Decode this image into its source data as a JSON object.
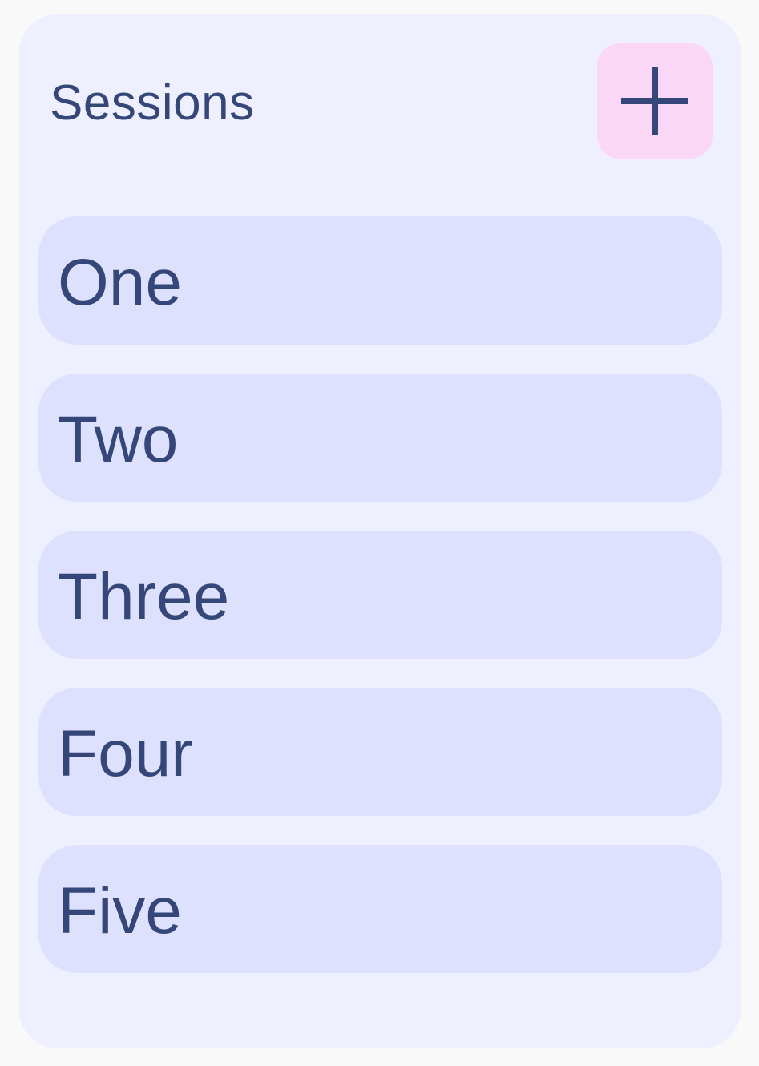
{
  "header": {
    "title": "Sessions",
    "add_icon": "plus-icon"
  },
  "sessions": [
    {
      "label": "One"
    },
    {
      "label": "Two"
    },
    {
      "label": "Three"
    },
    {
      "label": "Four"
    },
    {
      "label": "Five"
    }
  ],
  "colors": {
    "page_background": "#f9f9f9",
    "panel_background": "#eff0ff",
    "item_background": "#dee1fd",
    "add_button_background": "#fbd7f7",
    "text": "#354779"
  }
}
